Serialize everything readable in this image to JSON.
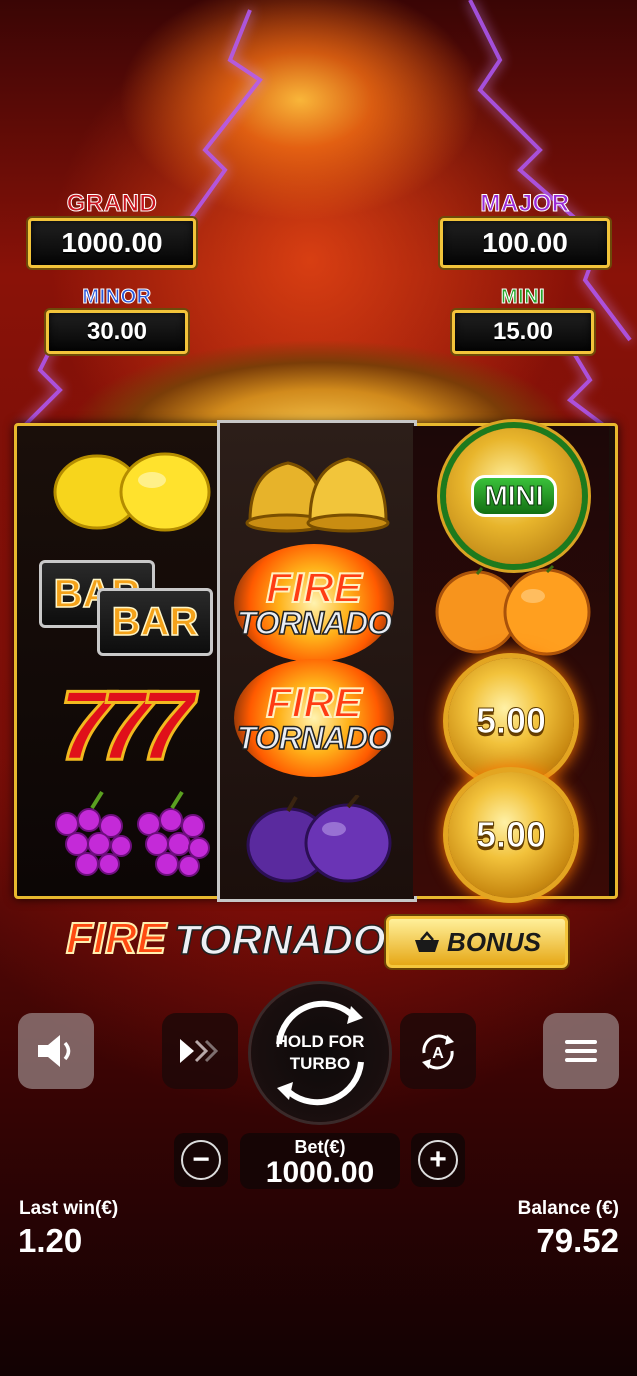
{
  "jackpots": {
    "grand": {
      "label": "GRAND",
      "value": "1000.00",
      "label_color": "#c8141e"
    },
    "major": {
      "label": "MAJOR",
      "value": "100.00",
      "label_color": "#9b2ad6"
    },
    "minor": {
      "label": "MINOR",
      "value": "30.00",
      "label_color": "#2a57d9"
    },
    "mini": {
      "label": "MINI",
      "value": "15.00",
      "label_color": "#27a52b"
    }
  },
  "reels": {
    "left": [
      "lemon",
      "bar",
      "seven",
      "grapes"
    ],
    "middle": [
      "bell",
      "fire-tornado",
      "fire-tornado",
      "plum"
    ],
    "right": [
      "mini-coin",
      "orange",
      "coin",
      "coin"
    ],
    "fire_tornado": {
      "line1": "FIRE",
      "line2": "TORNADO"
    },
    "bar_label": "BAR",
    "seven_label": "7",
    "mini_coin_label": "MINI",
    "coin_values": [
      "5.00",
      "5.00"
    ]
  },
  "logo": {
    "fire": "FIRE",
    "tornado": "TORNADO",
    "bonus": "BONUS"
  },
  "controls": {
    "sound_icon": "speaker-icon",
    "turbo_icon": "fast-forward-icon",
    "spin_line1": "HOLD FOR",
    "spin_line2": "TURBO",
    "autoplay_icon": "autoplay-icon",
    "menu_icon": "hamburger-icon"
  },
  "bet": {
    "label": "Bet(€)",
    "value": "1000.00",
    "minus": "−",
    "plus": "+"
  },
  "stats": {
    "last_win_label": "Last win(€)",
    "last_win_value": "1.20",
    "balance_label": "Balance (€)",
    "balance_value": "79.52"
  }
}
